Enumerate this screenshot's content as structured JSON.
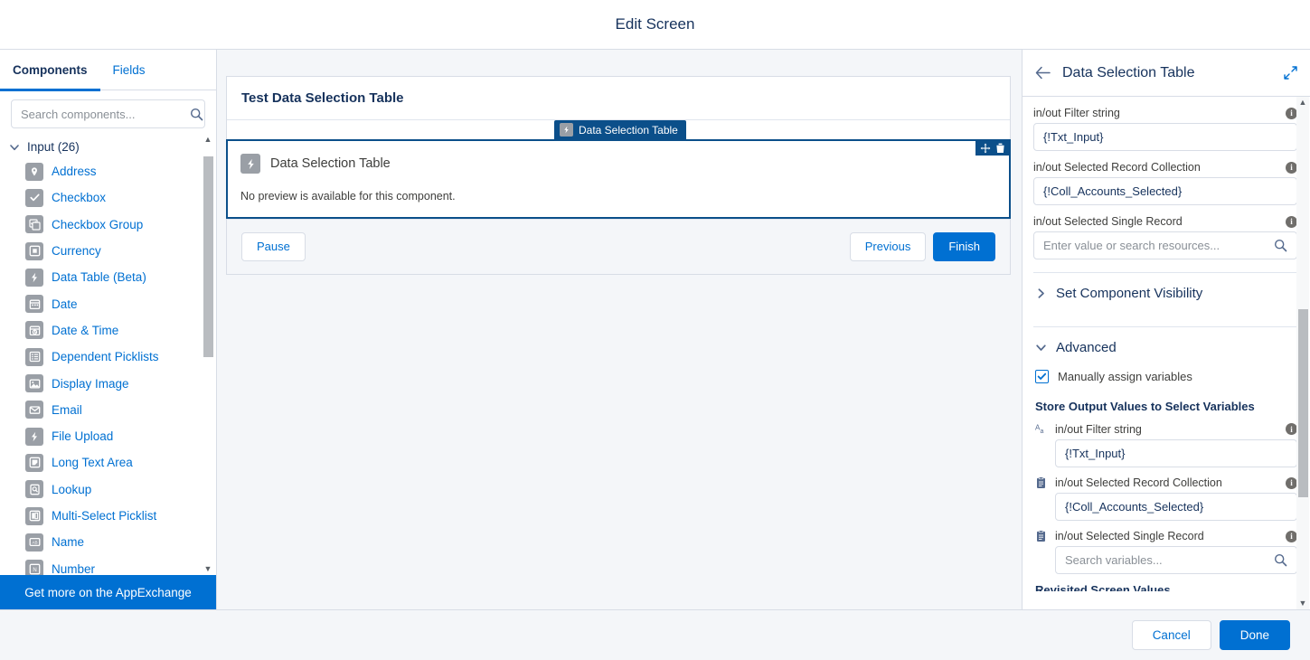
{
  "header": {
    "title": "Edit Screen"
  },
  "sidebar": {
    "tabs": [
      {
        "label": "Components",
        "active": true
      },
      {
        "label": "Fields",
        "active": false
      }
    ],
    "search": {
      "placeholder": "Search components...",
      "value": "",
      "icon": "search-icon"
    },
    "group": {
      "label": "Input (26)",
      "icon": "chevron-down-icon",
      "expanded": true
    },
    "items": [
      {
        "label": "Address",
        "icon": "location-pin-icon"
      },
      {
        "label": "Checkbox",
        "icon": "checkbox-icon"
      },
      {
        "label": "Checkbox Group",
        "icon": "checkbox-group-icon"
      },
      {
        "label": "Currency",
        "icon": "currency-icon"
      },
      {
        "label": "Data Table (Beta)",
        "icon": "lightning-icon"
      },
      {
        "label": "Date",
        "icon": "calendar-icon"
      },
      {
        "label": "Date & Time",
        "icon": "calendar-clock-icon"
      },
      {
        "label": "Dependent Picklists",
        "icon": "list-icon"
      },
      {
        "label": "Display Image",
        "icon": "image-icon"
      },
      {
        "label": "Email",
        "icon": "envelope-icon"
      },
      {
        "label": "File Upload",
        "icon": "lightning-icon"
      },
      {
        "label": "Long Text Area",
        "icon": "textarea-icon"
      },
      {
        "label": "Lookup",
        "icon": "lookup-icon"
      },
      {
        "label": "Multi-Select Picklist",
        "icon": "multipicklist-icon"
      },
      {
        "label": "Name",
        "icon": "name-icon"
      },
      {
        "label": "Number",
        "icon": "number-icon"
      }
    ],
    "appexchange_label": "Get more on the AppExchange"
  },
  "canvas": {
    "screen_title": "Test Data Selection Table",
    "component_tab": {
      "label": "Data Selection Table",
      "icon": "lightning-icon"
    },
    "component": {
      "title": "Data Selection Table",
      "icon": "lightning-icon",
      "preview_note": "No preview is available for this component.",
      "tools": [
        {
          "name": "move-handle-icon",
          "glyph": "drag"
        },
        {
          "name": "delete-icon",
          "glyph": "trash"
        }
      ]
    },
    "footer": {
      "pause_label": "Pause",
      "previous_label": "Previous",
      "finish_label": "Finish"
    }
  },
  "right_panel": {
    "back_icon": "arrow-left-icon",
    "title": "Data Selection Table",
    "expand_icon": "expand-icon",
    "inputs": [
      {
        "label": "in/out Filter string",
        "value": "{!Txt_Input}",
        "placeholder": "",
        "has_search": false
      },
      {
        "label": "in/out Selected Record Collection",
        "value": "{!Coll_Accounts_Selected}",
        "placeholder": "",
        "has_search": false
      },
      {
        "label": "in/out Selected Single Record",
        "value": "",
        "placeholder": "Enter value or search resources...",
        "has_search": true
      }
    ],
    "sections": [
      {
        "label": "Set Component Visibility",
        "expanded": false,
        "icon": "chevron-right-icon"
      },
      {
        "label": "Advanced",
        "expanded": true,
        "icon": "chevron-down-icon"
      }
    ],
    "advanced": {
      "checkbox": {
        "label": "Manually assign variables",
        "checked": true
      },
      "store_title": "Store Output Values to Select Variables",
      "outputs": [
        {
          "label": "in/out Filter string",
          "value": "{!Txt_Input}",
          "placeholder": "",
          "type_icon": "text-type-icon",
          "has_search": false
        },
        {
          "label": "in/out Selected Record Collection",
          "value": "{!Coll_Accounts_Selected}",
          "placeholder": "",
          "type_icon": "record-collection-icon",
          "has_search": false
        },
        {
          "label": "in/out Selected Single Record",
          "value": "",
          "placeholder": "Search variables...",
          "type_icon": "record-icon",
          "has_search": true
        }
      ],
      "clipped_heading": "Revisited Screen Values"
    }
  },
  "bottom_bar": {
    "cancel_label": "Cancel",
    "done_label": "Done"
  },
  "colors": {
    "brand_blue": "#0070d2",
    "dark_navy": "#0b4f8a",
    "text_dark": "#16325c",
    "border": "#d8dde6",
    "canvas_bg": "#f4f6f9"
  }
}
